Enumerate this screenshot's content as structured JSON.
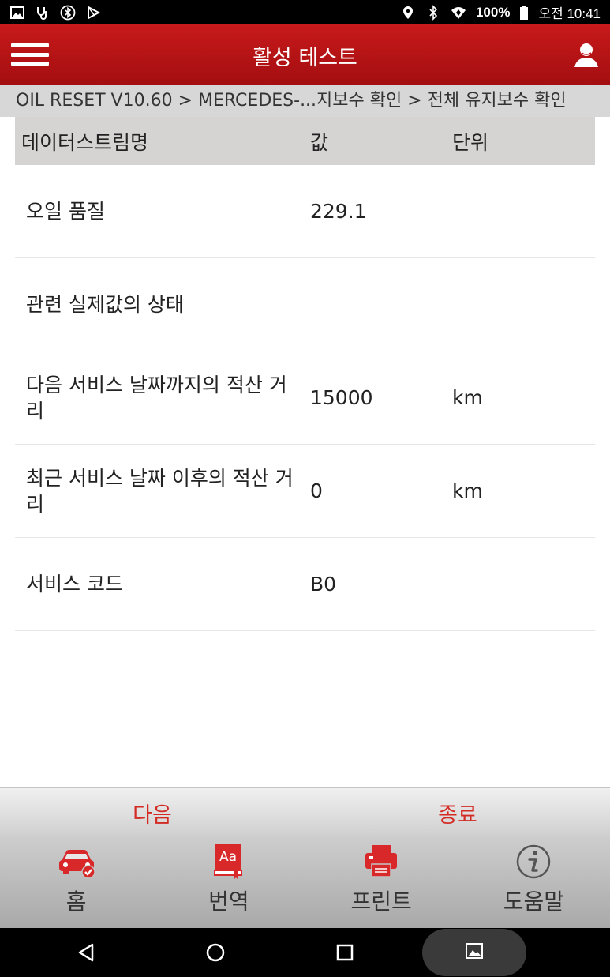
{
  "status_bar": {
    "battery": "100%",
    "time": "오전 10:41",
    "icons_left": [
      "gallery-icon",
      "stethoscope-icon",
      "bluetooth-circle-icon",
      "play-store-icon"
    ],
    "icons_right": [
      "location-icon",
      "bluetooth-icon",
      "wifi-icon",
      "battery-icon"
    ]
  },
  "app_bar": {
    "title": "활성 테스트",
    "menu_icon": "hamburger-menu-icon",
    "user_icon": "user-icon"
  },
  "breadcrumb": "OIL RESET V10.60 > MERCEDES-...지보수 확인 > 전체 유지보수 확인",
  "table": {
    "headers": {
      "name": "데이터스트림명",
      "value": "값",
      "unit": "단위"
    },
    "rows": [
      {
        "name": "오일 품질",
        "value": "229.1",
        "unit": ""
      },
      {
        "name": "관련 실제값의 상태",
        "value": "",
        "unit": ""
      },
      {
        "name": "다음 서비스 날짜까지의 적산 거리",
        "value": "15000",
        "unit": "km"
      },
      {
        "name": "최근 서비스 날짜 이후의 적산 거리",
        "value": "0",
        "unit": "km"
      },
      {
        "name": "서비스 코드",
        "value": "B0",
        "unit": ""
      }
    ]
  },
  "actions": {
    "next": "다음",
    "exit": "종료"
  },
  "bottom_nav": [
    {
      "label": "홈",
      "icon": "car-check-icon"
    },
    {
      "label": "번역",
      "icon": "translate-book-icon"
    },
    {
      "label": "프린트",
      "icon": "printer-icon"
    },
    {
      "label": "도움말",
      "icon": "info-icon"
    }
  ],
  "colors": {
    "brand_red": "#b81315",
    "action_text": "#d42a24",
    "header_gray": "#d6d3d3"
  }
}
